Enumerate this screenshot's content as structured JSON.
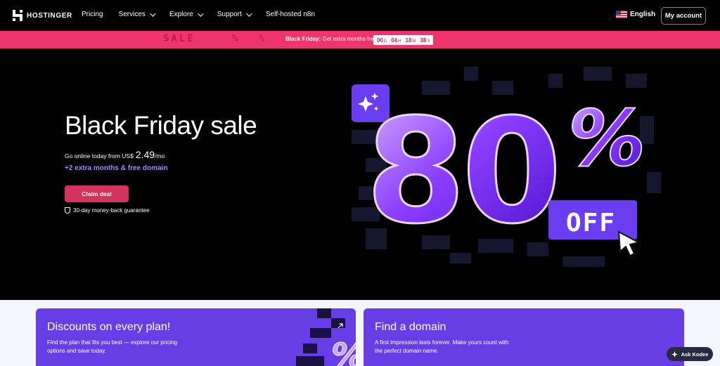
{
  "nav": {
    "logo_text": "HOSTINGER",
    "links": [
      {
        "label": "Pricing",
        "has_dropdown": false
      },
      {
        "label": "Services",
        "has_dropdown": true
      },
      {
        "label": "Explore",
        "has_dropdown": true
      },
      {
        "label": "Support",
        "has_dropdown": true
      },
      {
        "label": "Self-hosted n8n",
        "has_dropdown": false
      }
    ],
    "language": "English",
    "account_label": "My account"
  },
  "promo": {
    "ghost_sale": "SALE",
    "ghost_percent": "%",
    "label_bold": "Black Friday:",
    "label_rest": "Get extra months free",
    "timer": [
      {
        "value": "00",
        "unit": "D"
      },
      {
        "value": "04",
        "unit": "H"
      },
      {
        "value": "18",
        "unit": "M"
      },
      {
        "value": "38",
        "unit": "S"
      }
    ]
  },
  "hero": {
    "title": "Black Friday sale",
    "subtitle_prefix": "Go online today from US$",
    "price": "2.49",
    "per": "/mo",
    "extra": "+2 extra months & free domain",
    "cta": "Claim deal",
    "guarantee": "30-day money-back guarantee",
    "badge_number": "80",
    "badge_percent": "%",
    "badge_off": "OFF"
  },
  "cards": [
    {
      "title": "Discounts on every plan!",
      "desc": "Find the plan that fits you best — explore our pricing options and save today."
    },
    {
      "title": "Find a domain",
      "desc": "A first impression lasts forever. Make yours count with the perfect domain name."
    }
  ],
  "assistant": {
    "label": "Ask Kodee"
  },
  "colors": {
    "brand": "#673de6",
    "promo": "#f0346d",
    "cta": "#d4335e",
    "accent_text": "#a886ff"
  }
}
